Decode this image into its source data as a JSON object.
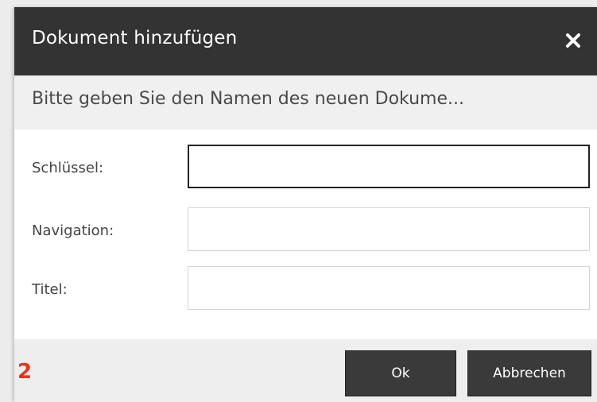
{
  "dialog": {
    "title": "Dokument hinzufügen",
    "close_icon": "close-icon",
    "subtitle": "Bitte geben Sie den Namen des neuen Dokume..."
  },
  "form": {
    "fields": [
      {
        "label": "Schlüssel:",
        "value": "",
        "focused": true
      },
      {
        "label": "Navigation:",
        "value": "",
        "focused": false
      },
      {
        "label": "Titel:",
        "value": "",
        "focused": false
      }
    ]
  },
  "buttons": {
    "ok_label": "Ok",
    "cancel_label": "Abbrechen"
  },
  "annotation": {
    "step_number": "2"
  },
  "colors": {
    "titlebar": "#333333",
    "button": "#3a3a3a",
    "step_marker": "#e8361b"
  }
}
